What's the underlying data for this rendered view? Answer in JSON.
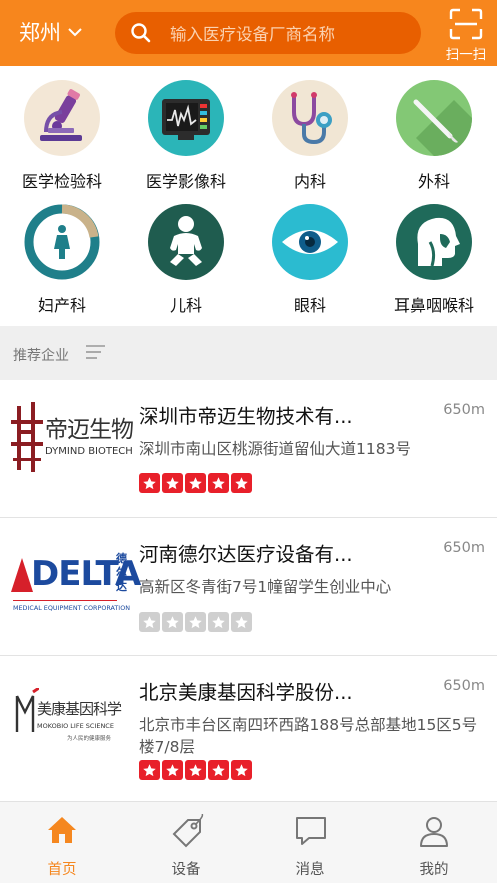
{
  "colors": {
    "accent": "#f7861d",
    "search_bg": "#e85f00",
    "star_on": "#e8202a",
    "star_off": "#cfcfcf"
  },
  "header": {
    "city": "郑州",
    "search_placeholder": "输入医疗设备厂商名称",
    "scan_label": "扫一扫"
  },
  "categories": [
    {
      "label": "医学检验科",
      "icon": "microscope-icon"
    },
    {
      "label": "医学影像科",
      "icon": "monitor-icon"
    },
    {
      "label": "内科",
      "icon": "stethoscope-icon"
    },
    {
      "label": "外科",
      "icon": "scalpel-icon"
    },
    {
      "label": "妇产科",
      "icon": "woman-icon"
    },
    {
      "label": "儿科",
      "icon": "baby-icon"
    },
    {
      "label": "眼科",
      "icon": "eye-icon"
    },
    {
      "label": "耳鼻咽喉科",
      "icon": "head-profile-icon"
    }
  ],
  "recommended": {
    "title": "推荐企业"
  },
  "companies": [
    {
      "name": "深圳市帝迈生物技术有...",
      "distance": "650m",
      "address": "深圳市南山区桃源街道留仙大道1183号",
      "rating": 5,
      "logo": {
        "cn": "帝迈生物",
        "en": "DYMIND BIOTECH"
      }
    },
    {
      "name": "河南德尔达医疗设备有...",
      "distance": "650m",
      "address": "高新区冬青街7号1幢留学生创业中心",
      "rating": 0,
      "logo": {
        "main": "DELTA",
        "side": "德尔达",
        "en": "MEDICAL EQUIPMENT CORPORATION"
      }
    },
    {
      "name": "北京美康基因科学股份...",
      "distance": "650m",
      "address": "北京市丰台区南四环西路188号总部基地15区5号楼7/8层",
      "rating": 5,
      "logo": {
        "cn": "美康基因科学",
        "en": "MOKOBIO LIFE SCIENCE",
        "tagline": "为人民的健康服务"
      }
    }
  ],
  "tabs": [
    {
      "label": "首页",
      "icon": "home-icon",
      "active": true
    },
    {
      "label": "设备",
      "icon": "tag-icon",
      "active": false
    },
    {
      "label": "消息",
      "icon": "message-icon",
      "active": false
    },
    {
      "label": "我的",
      "icon": "user-icon",
      "active": false
    }
  ]
}
